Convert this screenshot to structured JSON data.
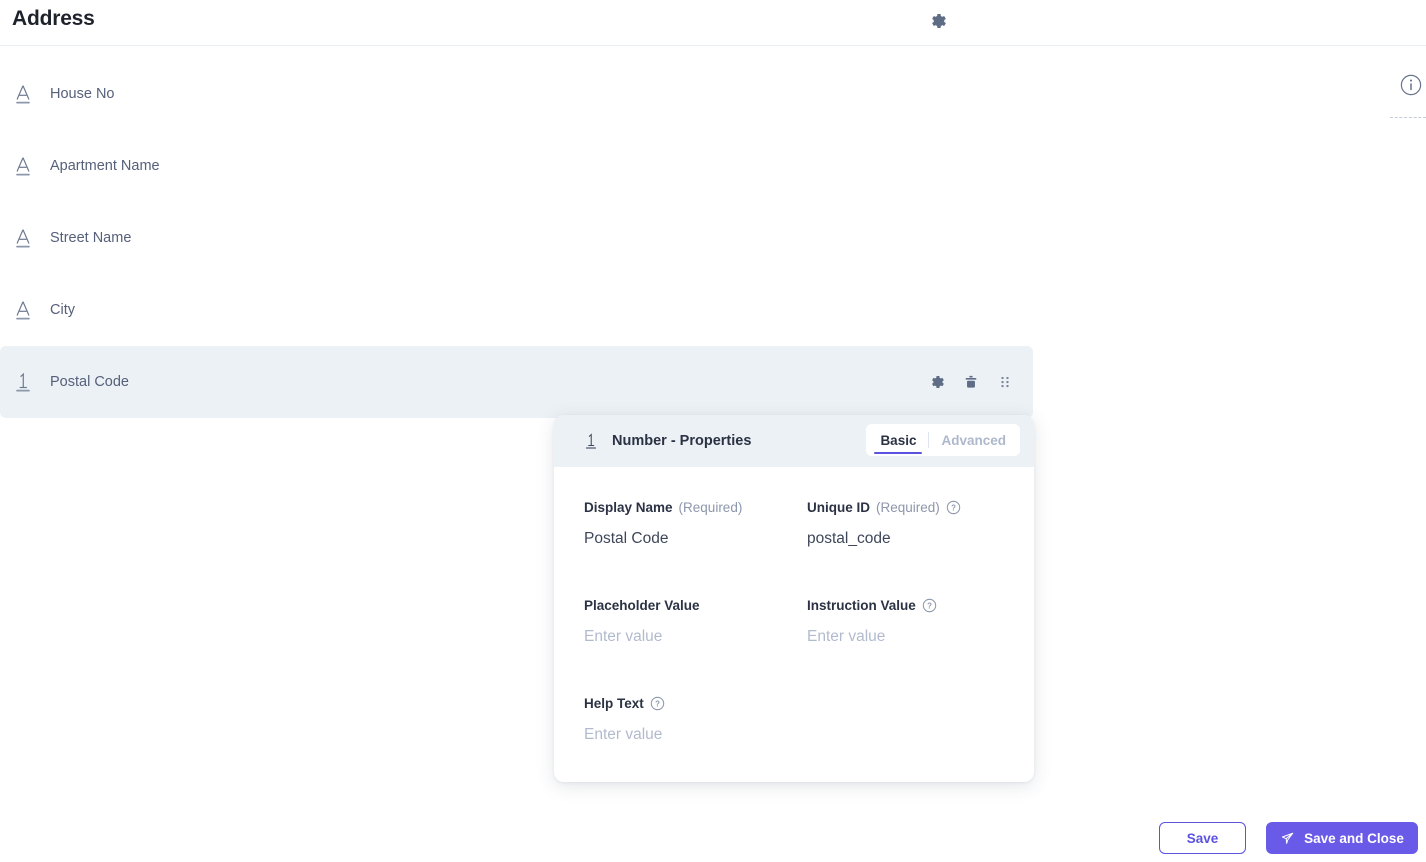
{
  "header": {
    "title": "Address",
    "gear_icon": "gear-icon"
  },
  "top_right": {
    "info_icon": "info-icon"
  },
  "fields": [
    {
      "label": "House No",
      "type_icon": "text-field-icon",
      "selected": false
    },
    {
      "label": "Apartment Name",
      "type_icon": "text-field-icon",
      "selected": false
    },
    {
      "label": "Street Name",
      "type_icon": "text-field-icon",
      "selected": false
    },
    {
      "label": "City",
      "type_icon": "text-field-icon",
      "selected": false
    },
    {
      "label": "Postal Code",
      "type_icon": "number-field-icon",
      "selected": true
    }
  ],
  "row_actions": {
    "settings_icon": "gear-icon",
    "delete_icon": "trash-icon",
    "drag_icon": "drag-handle-icon"
  },
  "properties_panel": {
    "type_icon": "number-field-icon",
    "title": "Number - Properties",
    "tabs": [
      {
        "label": "Basic",
        "active": true
      },
      {
        "label": "Advanced",
        "active": false
      }
    ],
    "fields": {
      "display_name": {
        "label": "Display Name",
        "required_text": "(Required)",
        "value": "Postal Code",
        "has_help": false
      },
      "unique_id": {
        "label": "Unique ID",
        "required_text": "(Required)",
        "value": "postal_code",
        "has_help": true,
        "help_icon": "question-mark-icon"
      },
      "placeholder_value": {
        "label": "Placeholder Value",
        "required_text": "",
        "value": "",
        "placeholder": "Enter value",
        "has_help": false
      },
      "instruction_value": {
        "label": "Instruction Value",
        "required_text": "",
        "value": "",
        "placeholder": "Enter value",
        "has_help": true,
        "help_icon": "question-mark-icon"
      },
      "help_text": {
        "label": "Help Text",
        "required_text": "",
        "value": "",
        "placeholder": "Enter value",
        "has_help": true,
        "help_icon": "question-mark-icon"
      }
    }
  },
  "footer": {
    "save_label": "Save",
    "save_and_close_label": "Save and Close",
    "save_and_close_icon": "send-icon"
  },
  "colors": {
    "accent": "#6a5ae8",
    "accent_outline": "#5b52e0",
    "row_selected_bg": "#ecf1f5",
    "label_text": "#2b3243",
    "muted_text": "#8d97ab",
    "placeholder_text": "#b2bacd"
  }
}
